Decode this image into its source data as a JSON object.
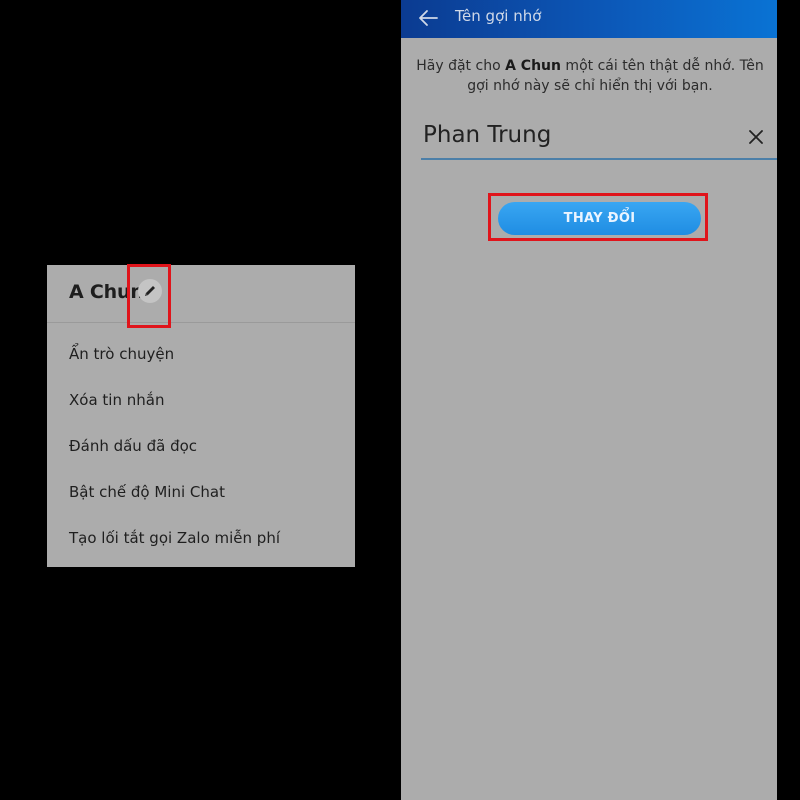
{
  "menu": {
    "title": "A Chun",
    "items": [
      {
        "label": "Ẩn trò chuyện"
      },
      {
        "label": "Xóa tin nhắn"
      },
      {
        "label": "Đánh dấu đã đọc"
      },
      {
        "label": "Bật chế độ Mini Chat"
      },
      {
        "label": "Tạo lối tắt gọi Zalo miễn phí"
      }
    ]
  },
  "nickname_screen": {
    "title": "Tên gợi nhớ",
    "description_prefix": "Hãy đặt cho ",
    "description_name": "A Chun",
    "description_suffix": " một cái tên thật dễ nhớ. Tên gợi nhớ này sẽ chỉ hiển thị với bạn.",
    "input_value": "Phan Trung",
    "submit_label": "THAY ĐỔI"
  },
  "icons": {
    "edit": "pencil-icon",
    "back": "back-arrow-icon",
    "clear": "close-icon"
  },
  "colors": {
    "highlight": "#e0141b",
    "button": "#2196f3",
    "appbar": "#0c58b8"
  }
}
